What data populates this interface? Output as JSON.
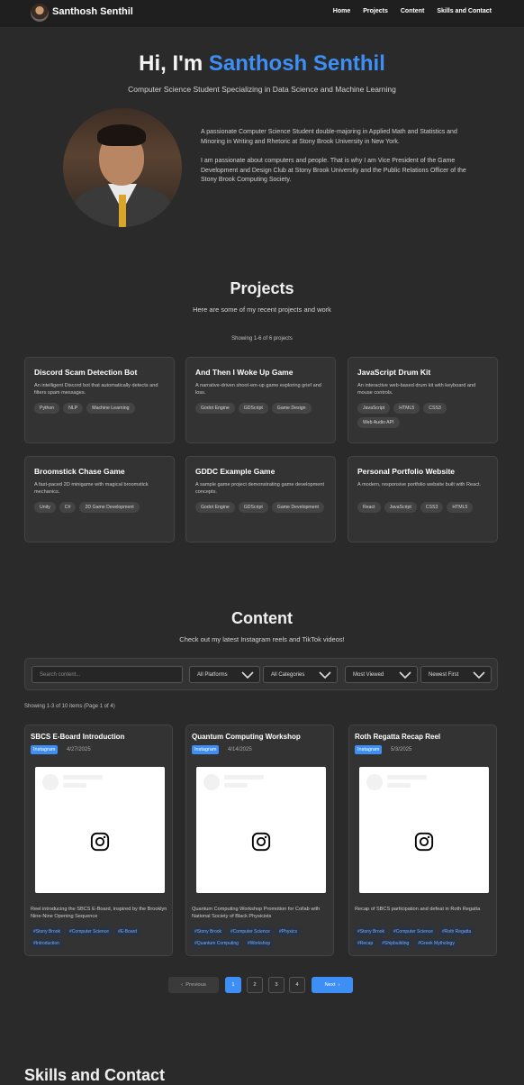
{
  "nav": {
    "brand": "Santhosh Senthil",
    "links": [
      "Home",
      "Projects",
      "Content",
      "Skills and Contact"
    ]
  },
  "hero": {
    "greeting": "Hi, I'm",
    "name": "Santhosh Senthil",
    "subtitle": "Computer Science Student Specializing in Data Science and Machine Learning",
    "about_1": "A passionate Computer Science Student double-majoring in Applied Math and Statistics and Minoring in Writing and Rhetoric at Stony Brook University in New York.",
    "about_2": "I am passionate about computers and people. That is why I am Vice President of the Game Development and Design Club at Stony Brook University and the Public Relations Officer of the Stony Brook Computing Society."
  },
  "projects": {
    "title": "Projects",
    "subtitle": "Here are some of my recent projects and work",
    "showing": "Showing 1-6 of 6 projects",
    "items": [
      {
        "title": "Discord Scam Detection Bot",
        "desc": "An intelligent Discord bot that automatically detects and filters spam messages.",
        "tags": [
          "Python",
          "NLP",
          "Machine Learning"
        ]
      },
      {
        "title": "And Then I Woke Up Game",
        "desc": "A narrative-driven shoot-em-up game exploring grief and loss.",
        "tags": [
          "Godot Engine",
          "GDScript",
          "Game Design"
        ]
      },
      {
        "title": "JavaScript Drum Kit",
        "desc": "An interactive web-based drum kit with keyboard and mouse controls.",
        "tags": [
          "JavaScript",
          "HTML5",
          "CSS3",
          "Web Audio API"
        ]
      },
      {
        "title": "Broomstick Chase Game",
        "desc": "A fast-paced 2D minigame with magical broomstick mechanics.",
        "tags": [
          "Unity",
          "C#",
          "2D Game Development"
        ]
      },
      {
        "title": "GDDC Example Game",
        "desc": "A sample game project demonstrating game development concepts.",
        "tags": [
          "Godot Engine",
          "GDScript",
          "Game Development"
        ]
      },
      {
        "title": "Personal Portfolio Website",
        "desc": "A modern, responsive portfolio website built with React.",
        "tags": [
          "React",
          "JavaScript",
          "CSS3",
          "HTML5"
        ]
      }
    ]
  },
  "content": {
    "title": "Content",
    "subtitle": "Check out my latest Instagram reels and TikTok videos!",
    "search_placeholder": "Search content...",
    "filters": {
      "platform": "All Platforms",
      "category": "All Categories",
      "sort": "Most Viewed",
      "order": "Newest First"
    },
    "showing": "Showing 1-3 of 10 items (Page 1 of 4)",
    "items": [
      {
        "title": "SBCS E-Board Introduction",
        "platform": "Instagram",
        "date": "4/27/2025",
        "desc": "Reel introducing the SBCS E-Board, inspired by the Brooklyn Nine-Nine Opening Sequence",
        "tags": [
          "#Stony Brook",
          "#Computer Science",
          "#E-Board",
          "#Introduction"
        ]
      },
      {
        "title": "Quantum Computing Workshop",
        "platform": "Instagram",
        "date": "4/14/2025",
        "desc": "Quantum Computing Workshop Promotion for Collab with National Society of Black Physicists",
        "tags": [
          "#Stony Brook",
          "#Computer Science",
          "#Physics",
          "#Quantum Computing",
          "#Workshop"
        ]
      },
      {
        "title": "Roth Regatta Recap Reel",
        "platform": "Instagram",
        "date": "5/3/2025",
        "desc": "Recap of SBCS participation and defeat in Roth Regatta",
        "tags": [
          "#Stony Brook",
          "#Computer Science",
          "#Roth Regatta",
          "#Recap",
          "#Shipbuilding",
          "#Greek Mythology"
        ]
      }
    ],
    "pagination": {
      "prev": "Previous",
      "pages": [
        "1",
        "2",
        "3",
        "4"
      ],
      "current": "1",
      "next": "Next"
    }
  },
  "skills": {
    "title": "Skills and Contact"
  },
  "colors": {
    "accent": "#3d8ef5",
    "background": "#2a2a2a",
    "card": "#333333"
  }
}
